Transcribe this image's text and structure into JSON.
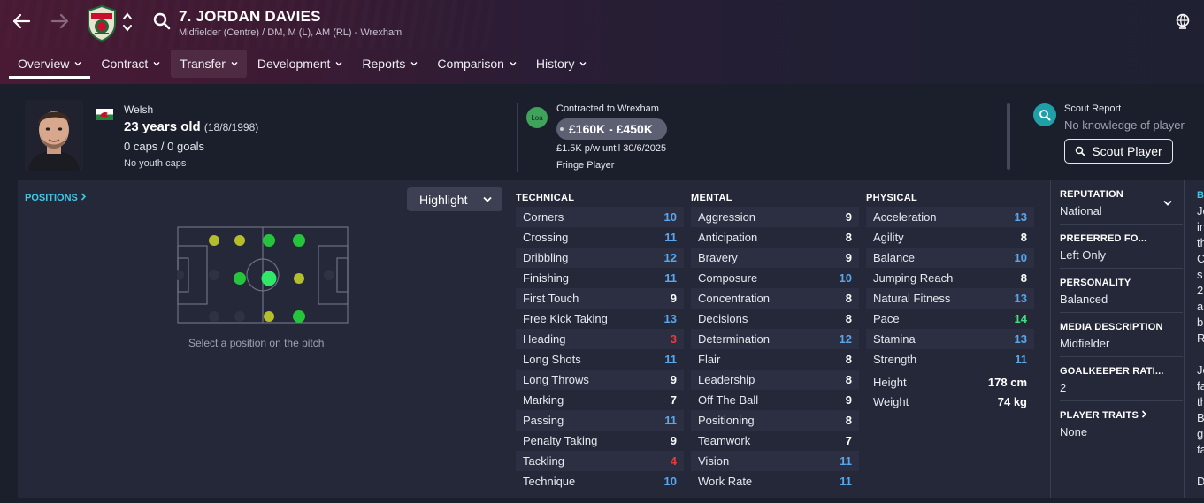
{
  "header": {
    "player_name": "7. JORDAN DAVIES",
    "player_sub": "Midfielder (Centre) / DM, M (L), AM (RL) - Wrexham"
  },
  "tabs": [
    {
      "label": "Overview"
    },
    {
      "label": "Contract"
    },
    {
      "label": "Transfer"
    },
    {
      "label": "Development"
    },
    {
      "label": "Reports"
    },
    {
      "label": "Comparison"
    },
    {
      "label": "History"
    }
  ],
  "profile": {
    "nationality": "Welsh",
    "age": "23 years old",
    "dob": "(18/8/1998)",
    "caps": "0 caps / 0 goals",
    "youth_caps": "No youth caps"
  },
  "contract": {
    "badge": "Loa",
    "contracted_to": "Contracted to Wrexham",
    "value_range": "£160K - £450K",
    "wage": "£1.5K p/w until 30/6/2025",
    "squad_status": "Fringe Player"
  },
  "scout": {
    "title": "Scout Report",
    "knowledge": "No knowledge of player",
    "button": "Scout Player"
  },
  "positions": {
    "title": "POSITIONS",
    "highlight_label": "Highlight",
    "hint": "Select a position on the pitch"
  },
  "technical": {
    "title": "TECHNICAL",
    "rows": [
      {
        "name": "Corners",
        "value": "10",
        "color": "blue"
      },
      {
        "name": "Crossing",
        "value": "11",
        "color": "blue"
      },
      {
        "name": "Dribbling",
        "value": "12",
        "color": "blue"
      },
      {
        "name": "Finishing",
        "value": "11",
        "color": "blue"
      },
      {
        "name": "First Touch",
        "value": "9",
        "color": "white"
      },
      {
        "name": "Free Kick Taking",
        "value": "13",
        "color": "blue"
      },
      {
        "name": "Heading",
        "value": "3",
        "color": "red"
      },
      {
        "name": "Long Shots",
        "value": "11",
        "color": "blue"
      },
      {
        "name": "Long Throws",
        "value": "9",
        "color": "white"
      },
      {
        "name": "Marking",
        "value": "7",
        "color": "white"
      },
      {
        "name": "Passing",
        "value": "11",
        "color": "blue"
      },
      {
        "name": "Penalty Taking",
        "value": "9",
        "color": "white"
      },
      {
        "name": "Tackling",
        "value": "4",
        "color": "red"
      },
      {
        "name": "Technique",
        "value": "10",
        "color": "blue"
      }
    ]
  },
  "mental": {
    "title": "MENTAL",
    "rows": [
      {
        "name": "Aggression",
        "value": "9",
        "color": "white"
      },
      {
        "name": "Anticipation",
        "value": "8",
        "color": "white"
      },
      {
        "name": "Bravery",
        "value": "9",
        "color": "white"
      },
      {
        "name": "Composure",
        "value": "10",
        "color": "blue"
      },
      {
        "name": "Concentration",
        "value": "8",
        "color": "white"
      },
      {
        "name": "Decisions",
        "value": "8",
        "color": "white"
      },
      {
        "name": "Determination",
        "value": "12",
        "color": "blue"
      },
      {
        "name": "Flair",
        "value": "8",
        "color": "white"
      },
      {
        "name": "Leadership",
        "value": "8",
        "color": "white"
      },
      {
        "name": "Off The Ball",
        "value": "9",
        "color": "white"
      },
      {
        "name": "Positioning",
        "value": "8",
        "color": "white"
      },
      {
        "name": "Teamwork",
        "value": "7",
        "color": "white"
      },
      {
        "name": "Vision",
        "value": "11",
        "color": "blue"
      },
      {
        "name": "Work Rate",
        "value": "11",
        "color": "blue"
      }
    ]
  },
  "physical": {
    "title": "PHYSICAL",
    "rows": [
      {
        "name": "Acceleration",
        "value": "13",
        "color": "blue"
      },
      {
        "name": "Agility",
        "value": "8",
        "color": "white"
      },
      {
        "name": "Balance",
        "value": "10",
        "color": "blue"
      },
      {
        "name": "Jumping Reach",
        "value": "8",
        "color": "white"
      },
      {
        "name": "Natural Fitness",
        "value": "13",
        "color": "blue"
      },
      {
        "name": "Pace",
        "value": "14",
        "color": "green"
      },
      {
        "name": "Stamina",
        "value": "13",
        "color": "blue"
      },
      {
        "name": "Strength",
        "value": "11",
        "color": "blue"
      }
    ],
    "height_label": "Height",
    "height": "178 cm",
    "weight_label": "Weight",
    "weight": "74 kg"
  },
  "info": {
    "reputation_label": "REPUTATION",
    "reputation": "National",
    "foot_label": "PREFERRED FO...",
    "foot": "Left Only",
    "personality_label": "PERSONALITY",
    "personality": "Balanced",
    "media_label": "MEDIA DESCRIPTION",
    "media": "Midfielder",
    "gk_label": "GOALKEEPER RATI...",
    "gk": "2",
    "traits_label": "PLAYER TRAITS",
    "traits": "None"
  },
  "bio": {
    "heading": "B",
    "lines": [
      "Jo",
      "in",
      "th",
      "C",
      "s",
      "2",
      "a",
      "b",
      "R",
      "",
      "Jo",
      "fa",
      "th",
      "B",
      "g",
      "fa",
      "",
      "D"
    ]
  },
  "colors": {
    "accent": "#3ec8e6",
    "blue": "#5aa6ea",
    "red": "#ea3b3b",
    "green": "#3fe07a",
    "panel": "#242839"
  },
  "icons": [
    "back-arrow-icon",
    "forward-arrow-icon",
    "club-crest-icon",
    "up-down-icon",
    "search-icon",
    "globe-icon",
    "chevron-down-icon",
    "wales-flag-icon",
    "search-icon",
    "chevron-right-icon"
  ]
}
